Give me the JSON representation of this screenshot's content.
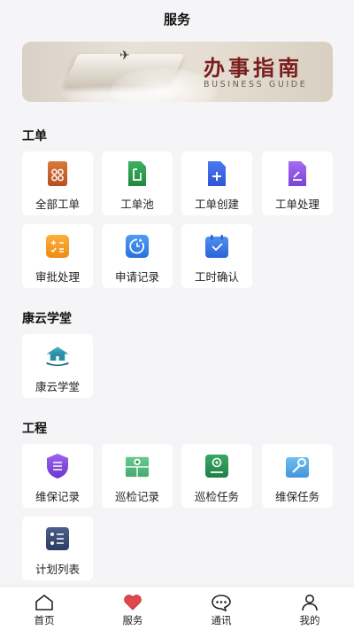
{
  "header": {
    "title": "服务"
  },
  "banner": {
    "title_cn": "办事指南",
    "title_en": "BUSINESS GUIDE"
  },
  "sections": [
    {
      "title": "工单",
      "items": [
        {
          "label": "全部工单",
          "icon": "all-orders-icon"
        },
        {
          "label": "工单池",
          "icon": "order-pool-icon"
        },
        {
          "label": "工单创建",
          "icon": "create-order-icon"
        },
        {
          "label": "工单处理",
          "icon": "process-order-icon"
        },
        {
          "label": "审批处理",
          "icon": "approval-icon"
        },
        {
          "label": "申请记录",
          "icon": "application-record-icon"
        },
        {
          "label": "工时确认",
          "icon": "work-hours-icon"
        }
      ]
    },
    {
      "title": "康云学堂",
      "items": [
        {
          "label": "康云学堂",
          "icon": "academy-icon"
        }
      ]
    },
    {
      "title": "工程",
      "items": [
        {
          "label": "维保记录",
          "icon": "maintenance-record-icon"
        },
        {
          "label": "巡检记录",
          "icon": "inspection-record-icon"
        },
        {
          "label": "巡检任务",
          "icon": "inspection-task-icon"
        },
        {
          "label": "维保任务",
          "icon": "maintenance-task-icon"
        },
        {
          "label": "计划列表",
          "icon": "plan-list-icon"
        }
      ]
    }
  ],
  "tabbar": [
    {
      "label": "首页",
      "icon": "home-icon"
    },
    {
      "label": "服务",
      "icon": "heart-icon",
      "active": true
    },
    {
      "label": "通讯",
      "icon": "chat-icon"
    },
    {
      "label": "我的",
      "icon": "user-icon"
    }
  ],
  "colors": {
    "background": "#f5f5f7",
    "accent": "#e0464b",
    "banner_title": "#7a1d1d"
  }
}
